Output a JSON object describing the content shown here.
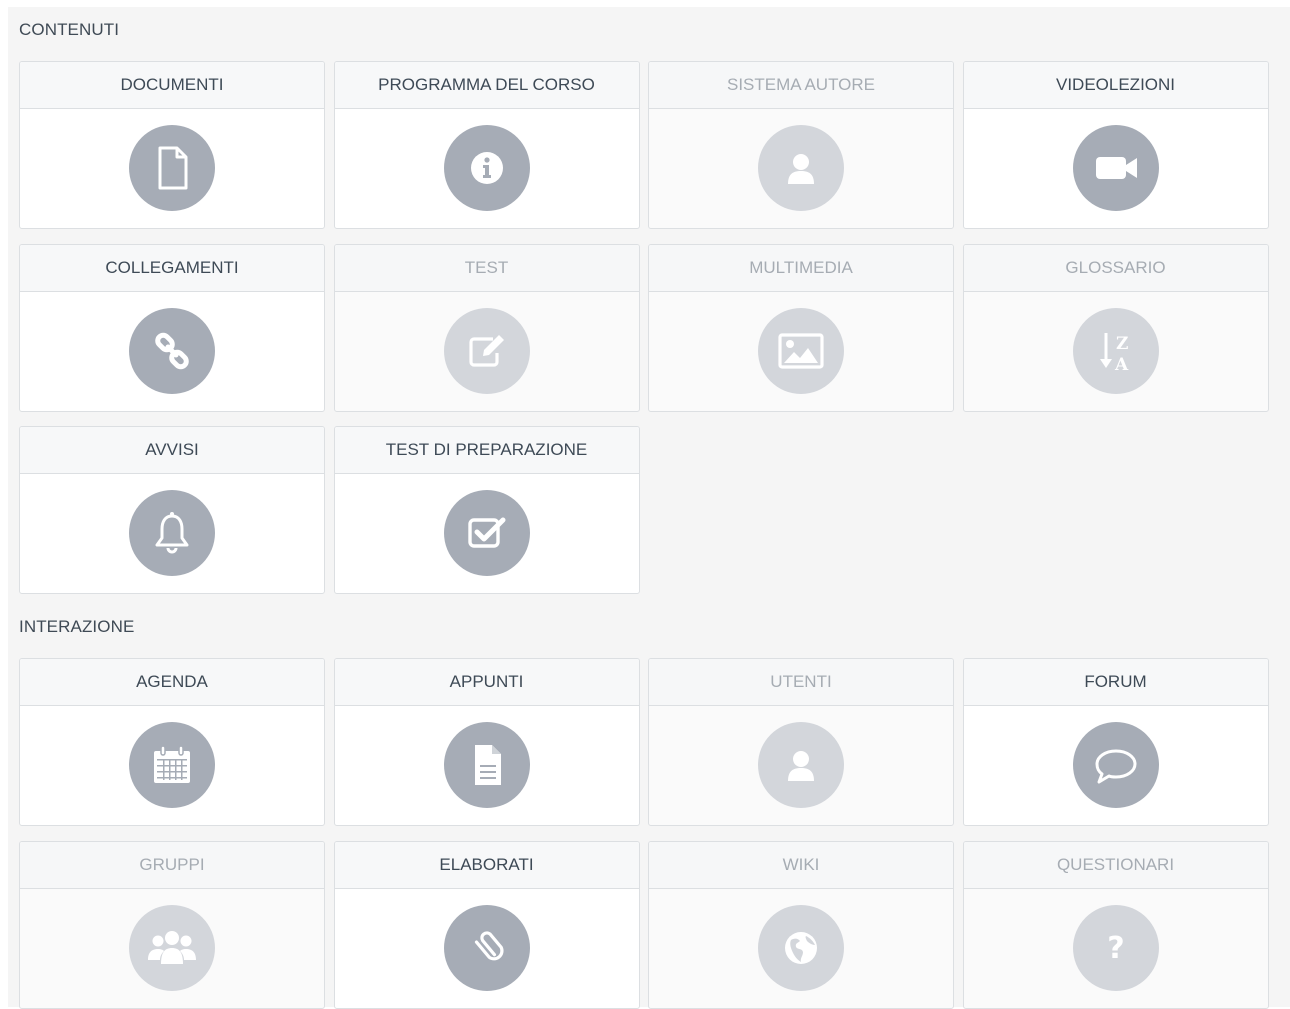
{
  "sections": [
    {
      "title": "CONTENUTI",
      "tiles": [
        {
          "label": "DOCUMENTI",
          "icon": "document-icon",
          "enabled": true
        },
        {
          "label": "PROGRAMMA DEL CORSO",
          "icon": "info-icon",
          "enabled": true
        },
        {
          "label": "SISTEMA AUTORE",
          "icon": "user-icon",
          "enabled": false
        },
        {
          "label": "VIDEOLEZIONI",
          "icon": "video-camera-icon",
          "enabled": true
        },
        {
          "label": "COLLEGAMENTI",
          "icon": "link-icon",
          "enabled": true
        },
        {
          "label": "TEST",
          "icon": "edit-icon",
          "enabled": false
        },
        {
          "label": "MULTIMEDIA",
          "icon": "image-icon",
          "enabled": false
        },
        {
          "label": "GLOSSARIO",
          "icon": "sort-alpha-icon",
          "enabled": false
        },
        {
          "label": "AVVISI",
          "icon": "bell-icon",
          "enabled": true
        },
        {
          "label": "TEST DI PREPARAZIONE",
          "icon": "checkbox-icon",
          "enabled": true
        }
      ]
    },
    {
      "title": "INTERAZIONE",
      "tiles": [
        {
          "label": "AGENDA",
          "icon": "calendar-icon",
          "enabled": true
        },
        {
          "label": "APPUNTI",
          "icon": "file-text-icon",
          "enabled": true
        },
        {
          "label": "UTENTI",
          "icon": "user-icon",
          "enabled": false
        },
        {
          "label": "FORUM",
          "icon": "comment-icon",
          "enabled": true
        },
        {
          "label": "GRUPPI",
          "icon": "group-icon",
          "enabled": false
        },
        {
          "label": "ELABORATI",
          "icon": "paperclip-icon",
          "enabled": true
        },
        {
          "label": "WIKI",
          "icon": "globe-icon",
          "enabled": false
        },
        {
          "label": "QUESTIONARI",
          "icon": "question-icon",
          "enabled": false
        }
      ]
    }
  ]
}
